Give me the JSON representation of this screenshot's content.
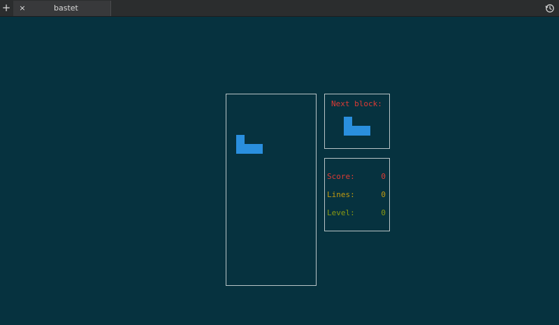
{
  "tabbar": {
    "add_icon": "+",
    "tab_close_icon": "×",
    "tab_title": "bastet"
  },
  "colors": {
    "background": "#06323f",
    "block": "#2a8fde",
    "border": "#b9c4c6",
    "score": "#dd3b35",
    "lines": "#c19a0f",
    "level": "#8a9a12",
    "next_label": "#dd3b35"
  },
  "next_block": {
    "label": "Next block:",
    "shape": "L",
    "cells": [
      [
        0,
        0
      ],
      [
        0,
        1
      ],
      [
        1,
        1
      ],
      [
        2,
        1
      ]
    ]
  },
  "current_block": {
    "shape": "L",
    "cells": [
      [
        0,
        0
      ],
      [
        0,
        1
      ],
      [
        1,
        1
      ],
      [
        2,
        1
      ]
    ]
  },
  "stats": {
    "score_label": "Score:",
    "score_value": "0",
    "lines_label": "Lines:",
    "lines_value": "0",
    "level_label": "Level:",
    "level_value": "0"
  },
  "icons": {
    "history": "history-icon"
  }
}
